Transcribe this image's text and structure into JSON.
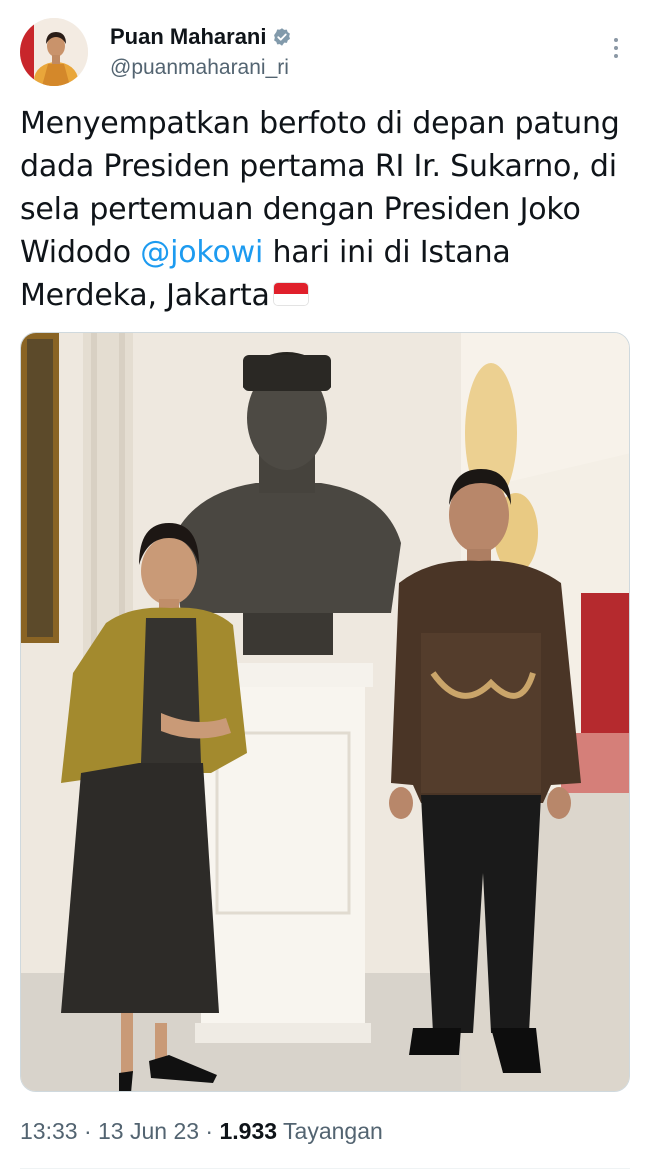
{
  "author": {
    "display_name": "Puan Maharani",
    "handle": "@puanmaharani_ri",
    "verified_icon": "verified-badge-icon",
    "avatar": "profile-photo"
  },
  "tweet": {
    "text_before": "Menyempatkan berfoto di depan patung dada Presiden pertama RI Ir. Sukarno, di sela pertemuan dengan Presiden Joko Widodo ",
    "mention": "@jokowi",
    "text_after": " hari ini di Istana Merdeka, Jakarta",
    "emoji": "indonesia-flag-emoji",
    "image": "photo-bust-sukarno-two-people"
  },
  "meta": {
    "time": "13:33",
    "sep1": " · ",
    "date": "13 Jun 23",
    "sep2": " · ",
    "views_count": "1.933",
    "views_label": " Tayangan"
  },
  "colors": {
    "text": "#0f1419",
    "secondary": "#536471",
    "link": "#1d9bf0",
    "verified": "#829aab"
  }
}
